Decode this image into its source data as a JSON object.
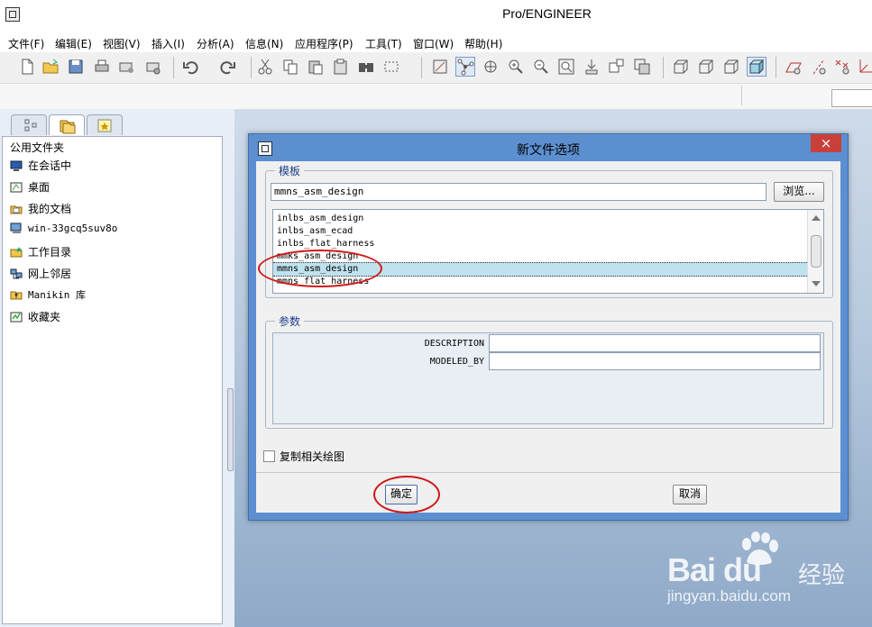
{
  "window": {
    "title": "Pro/ENGINEER"
  },
  "menu": [
    "文件(F)",
    "编辑(E)",
    "视图(V)",
    "插入(I)",
    "分析(A)",
    "信息(N)",
    "应用程序(P)",
    "工具(T)",
    "窗口(W)",
    "帮助(H)"
  ],
  "toolbar_icons": [
    "new-icon",
    "open-icon",
    "save-icon",
    "print-icon",
    "email-icon",
    "email-attach-icon",
    "undo-icon",
    "redo-icon",
    "cut-icon",
    "copy-icon",
    "paste-icon",
    "paste-special-icon",
    "find-icon",
    "select-box-icon",
    "repaint-icon",
    "spin-center-icon",
    "orient-icon",
    "zoom-in-icon",
    "zoom-out-icon",
    "refit-icon",
    "view-manager-icon",
    "saved-views-icon",
    "layers-icon",
    "wireframe-icon",
    "hidden-line-icon",
    "no-hidden-icon",
    "shading-icon",
    "datum-plane-icon",
    "datum-axis-icon",
    "datum-point-icon",
    "datum-csys-icon"
  ],
  "navigator": {
    "header": "公用文件夹",
    "items": [
      {
        "label": "在会话中",
        "icon": "in-session-icon"
      },
      {
        "label": "桌面",
        "icon": "desktop-icon"
      },
      {
        "label": "我的文档",
        "icon": "my-documents-icon"
      },
      {
        "label": "win-33gcq5suv8o",
        "icon": "computer-icon"
      },
      {
        "label": "工作目录",
        "icon": "working-directory-icon"
      },
      {
        "label": "网上邻居",
        "icon": "network-icon"
      },
      {
        "label": "Manikin 库",
        "icon": "manikin-library-icon"
      },
      {
        "label": "收藏夹",
        "icon": "favorites-icon"
      }
    ]
  },
  "dialog": {
    "title": "新文件选项",
    "close": "×",
    "template": {
      "legend": "模板",
      "value": "mmns_asm_design",
      "browse": "浏览...",
      "list": [
        "inlbs_asm_design",
        "inlbs_asm_ecad",
        "inlbs_flat_harness",
        "mmks_asm_design",
        "mmns_asm_design",
        "mmns_flat_harness"
      ],
      "selected": "mmns_asm_design"
    },
    "params": {
      "legend": "参数",
      "rows": [
        {
          "label": "DESCRIPTION",
          "value": ""
        },
        {
          "label": "MODELED_BY",
          "value": ""
        }
      ]
    },
    "copy_drawing": {
      "label": "复制相关绘图",
      "checked": false
    },
    "ok": "确定",
    "cancel": "取消"
  },
  "watermark": {
    "logo": "Bai du",
    "brand": "经验",
    "url": "jingyan.baidu.com"
  },
  "colors": {
    "dialog_frame": "#5c8fd0",
    "close_button": "#c9403a",
    "selection": "#bfe2ee",
    "annotation": "#d01818",
    "legend_text": "#1d3e8a"
  }
}
